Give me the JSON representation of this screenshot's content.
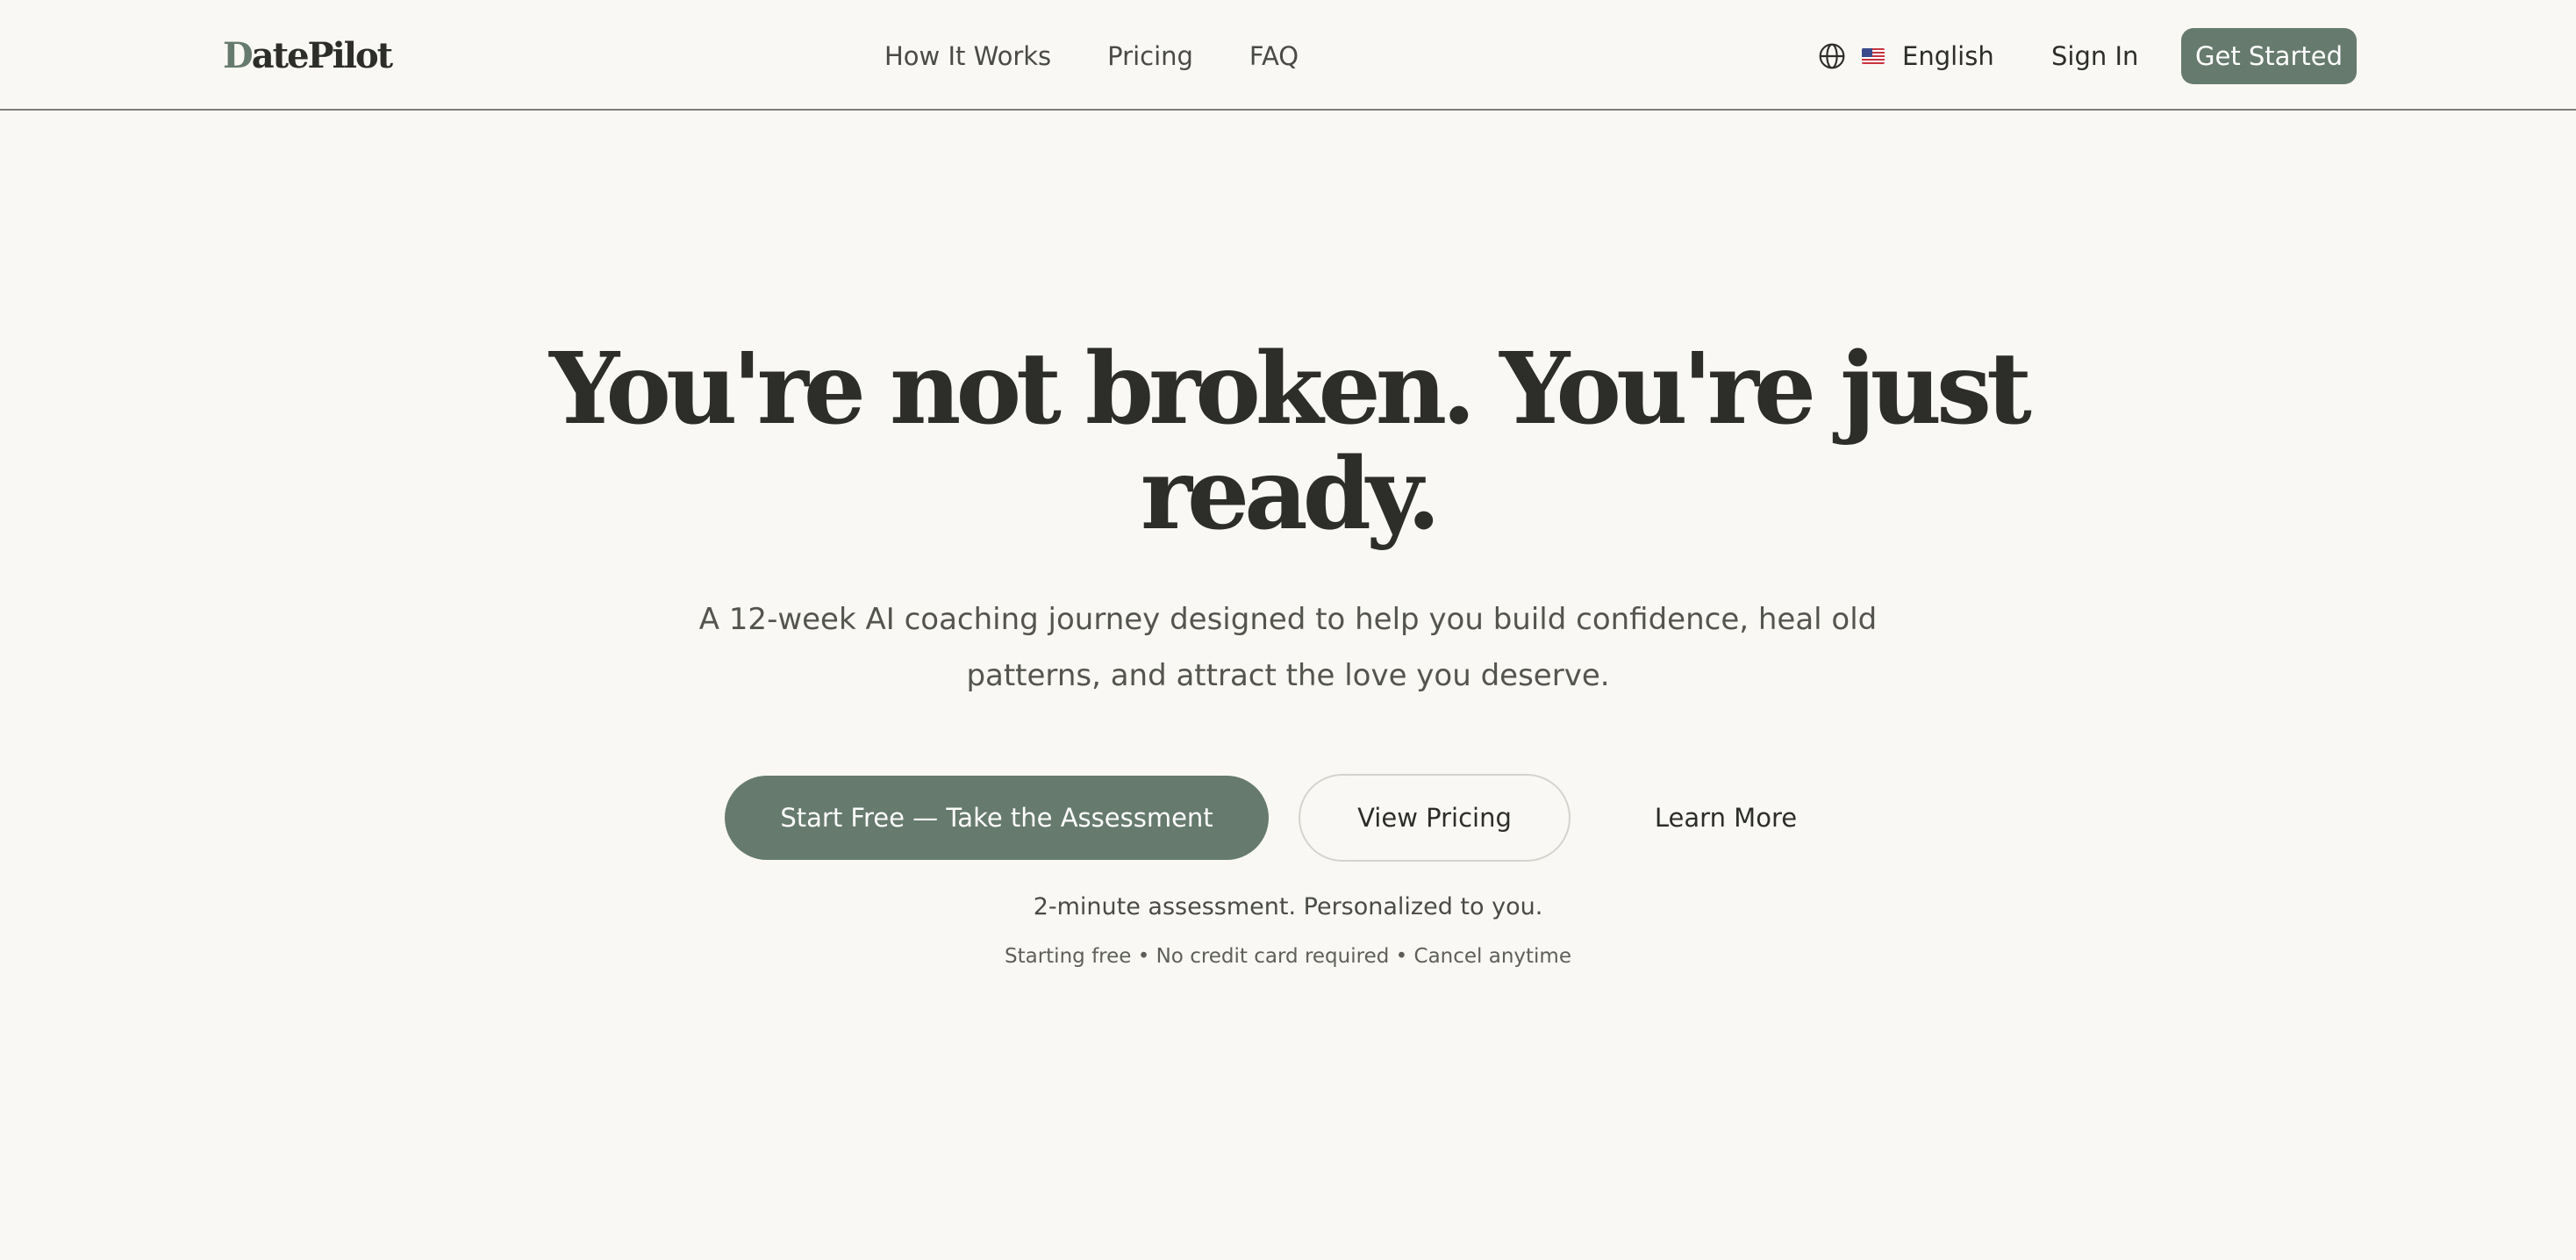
{
  "brand": {
    "first_letter": "D",
    "rest": "atePilot",
    "primary_color": "#667a6d",
    "background_color": "#f9f8f5"
  },
  "nav": {
    "items": [
      {
        "label": "How It Works"
      },
      {
        "label": "Pricing"
      },
      {
        "label": "FAQ"
      }
    ]
  },
  "language": {
    "icon": "globe-icon",
    "flag_icon": "us-flag-icon",
    "label": "English"
  },
  "auth": {
    "sign_in": "Sign In",
    "get_started": "Get Started"
  },
  "hero": {
    "title": "You're not broken. You're just ready.",
    "subtitle": "A 12-week AI coaching journey designed to help you build confidence, heal old patterns, and attract the love you deserve.",
    "primary_cta": "Start Free — Take the Assessment",
    "secondary_cta": "View Pricing",
    "tertiary_cta": "Learn More",
    "note": "2-minute assessment. Personalized to you.",
    "fine_print": "Starting free • No credit card required • Cancel anytime"
  }
}
